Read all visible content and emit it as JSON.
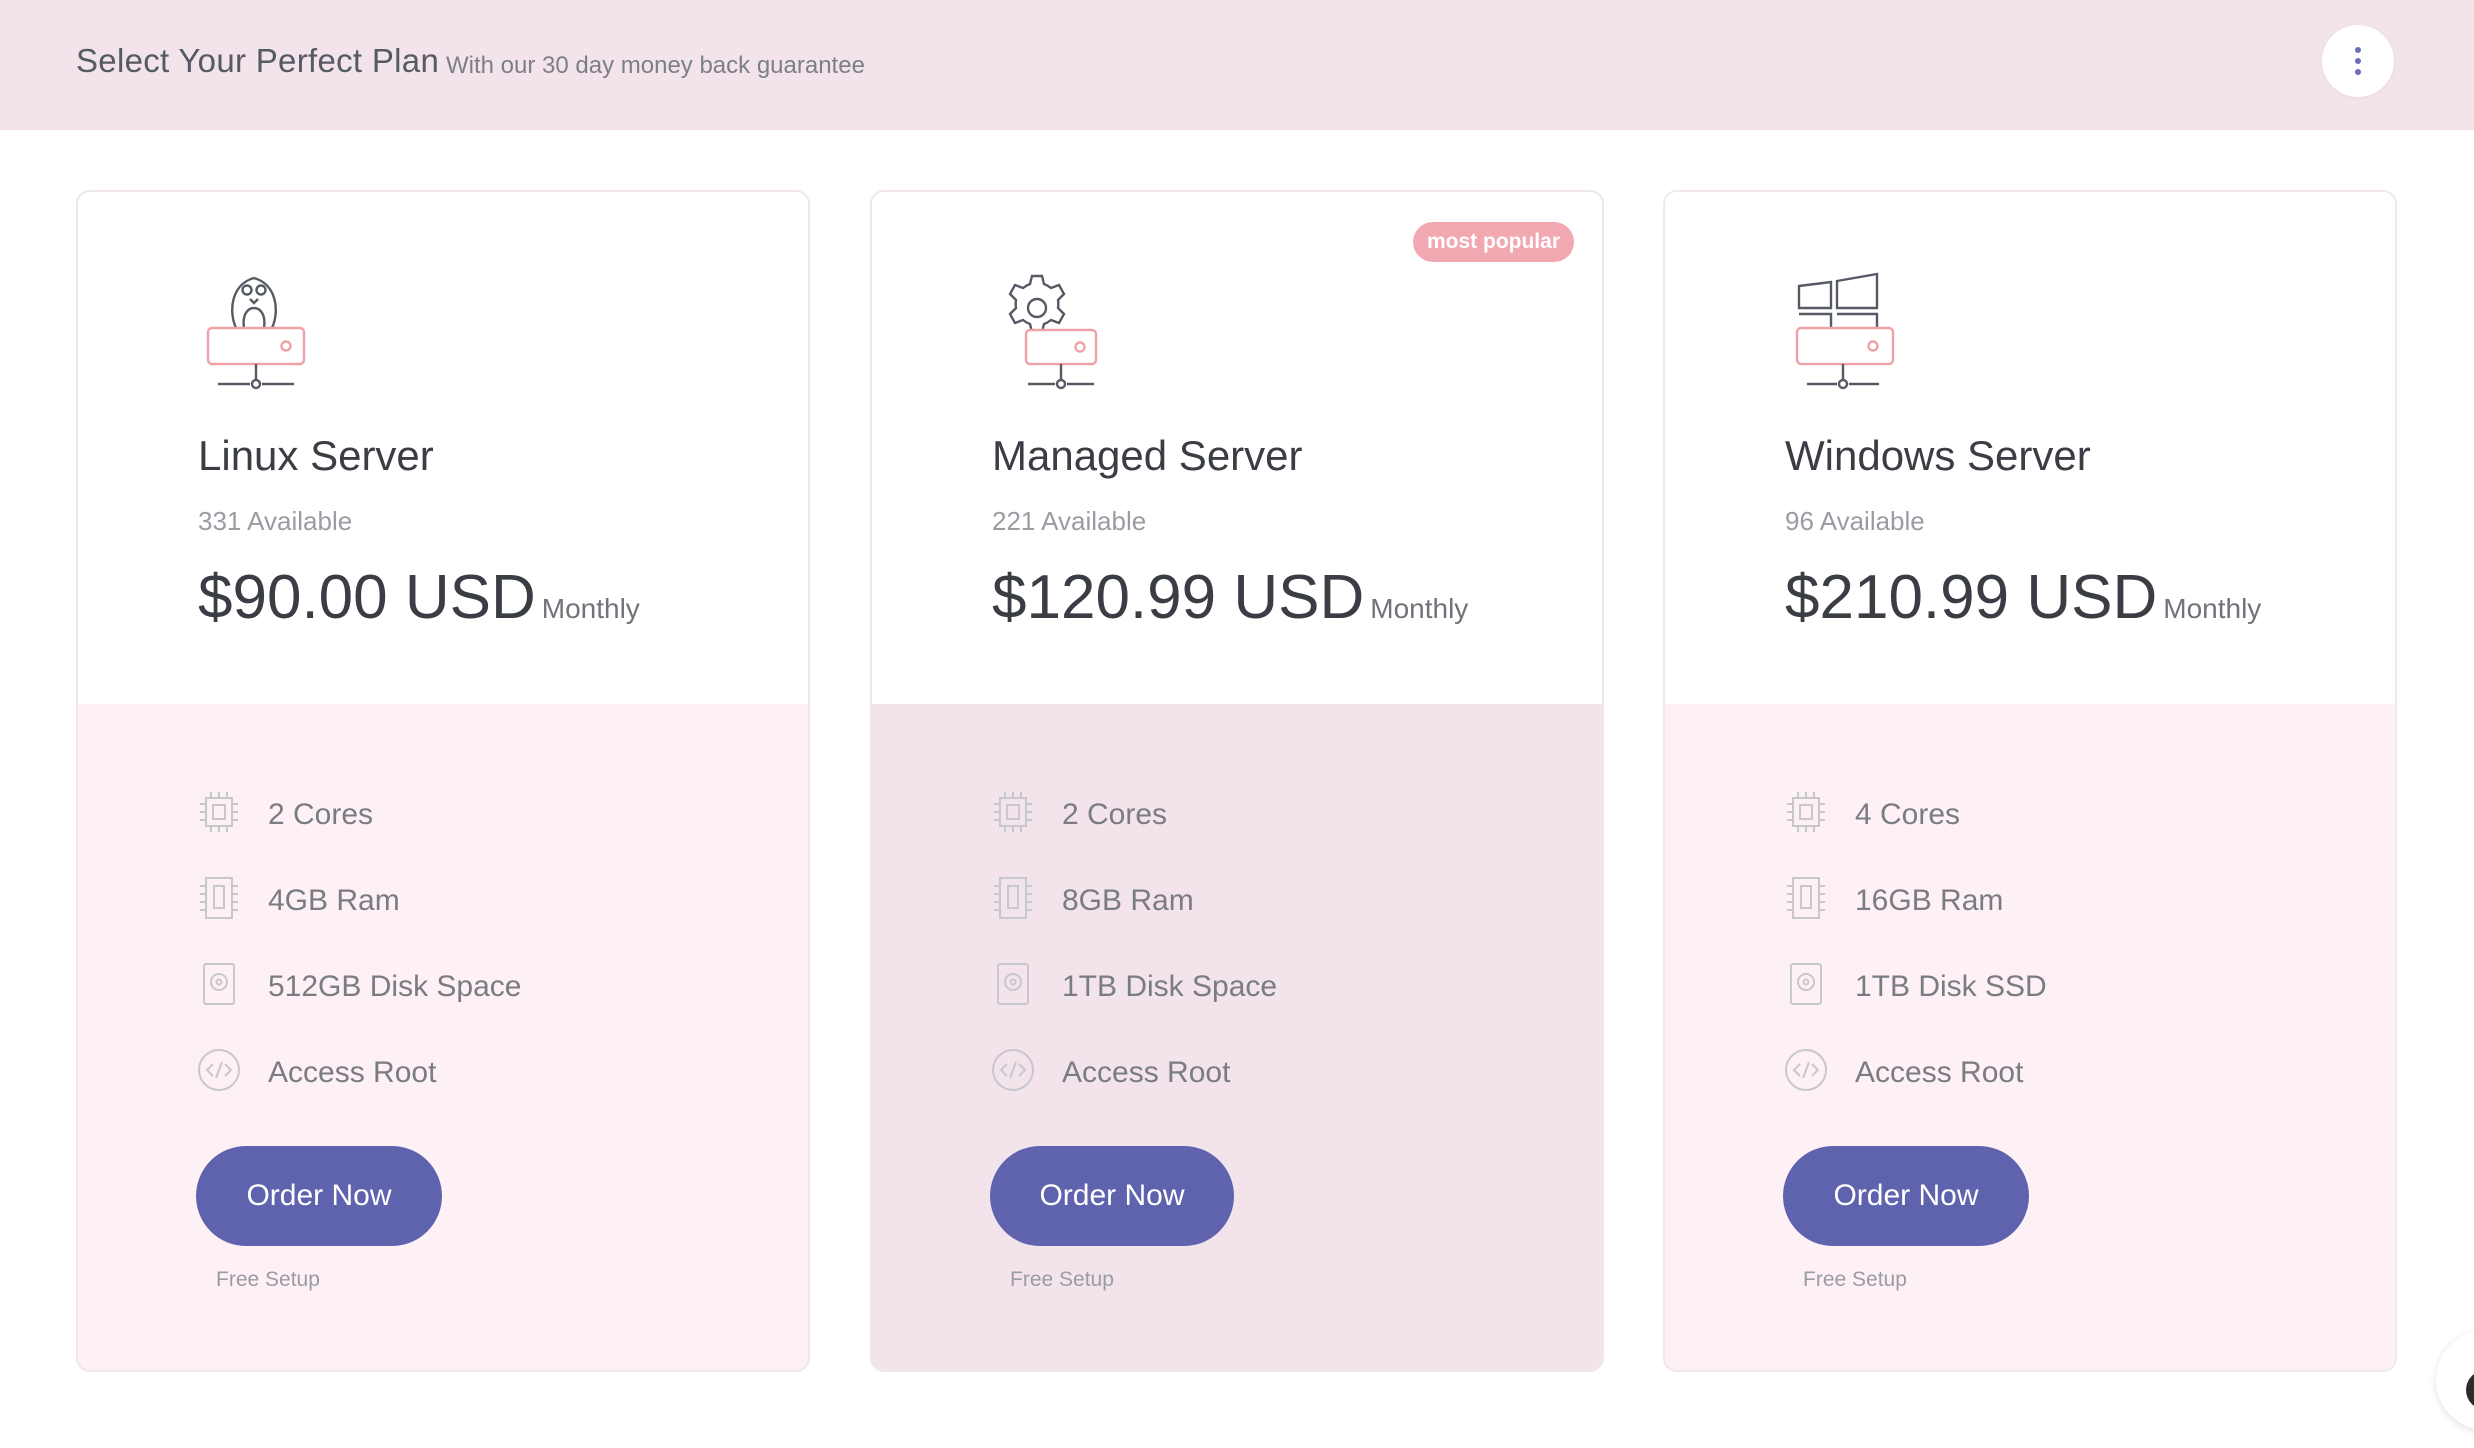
{
  "header": {
    "title": "Select Your Perfect Plan",
    "subtitle": "With our 30 day money back guarantee",
    "menu_icon": "kebab-vertical-icon"
  },
  "colors": {
    "header_bg": "#f3e4eb",
    "card_bottom_bg": "#fdf1f6",
    "featured_bottom_bg": "#f3e4eb",
    "button": "#5f63ad",
    "badge": "#f2a8b0",
    "accent_icon": "#f0a1a8"
  },
  "plans": [
    {
      "icon": "linux-server-icon",
      "name": "Linux Server",
      "available": "331 Available",
      "price": "$90.00 USD",
      "period": "Monthly",
      "features": [
        {
          "icon": "cpu-icon",
          "label": "2 Cores"
        },
        {
          "icon": "ram-icon",
          "label": "4GB Ram"
        },
        {
          "icon": "disk-icon",
          "label": "512GB Disk Space"
        },
        {
          "icon": "code-icon",
          "label": "Access Root"
        }
      ],
      "cta": "Order Now",
      "note": "Free Setup"
    },
    {
      "icon": "managed-server-icon",
      "name": "Managed Server",
      "badge": "most popular",
      "available": "221 Available",
      "price": "$120.99 USD",
      "period": "Monthly",
      "features": [
        {
          "icon": "cpu-icon",
          "label": "2 Cores"
        },
        {
          "icon": "ram-icon",
          "label": "8GB Ram"
        },
        {
          "icon": "disk-icon",
          "label": "1TB Disk Space"
        },
        {
          "icon": "code-icon",
          "label": "Access Root"
        }
      ],
      "cta": "Order Now",
      "note": "Free Setup"
    },
    {
      "icon": "windows-server-icon",
      "name": "Windows Server",
      "available": "96 Available",
      "price": "$210.99 USD",
      "period": "Monthly",
      "features": [
        {
          "icon": "cpu-icon",
          "label": "4 Cores"
        },
        {
          "icon": "ram-icon",
          "label": "16GB Ram"
        },
        {
          "icon": "disk-icon",
          "label": "1TB Disk SSD"
        },
        {
          "icon": "code-icon",
          "label": "Access Root"
        }
      ],
      "cta": "Order Now",
      "note": "Free Setup"
    }
  ],
  "chat_icon": "chat-launcher-icon"
}
